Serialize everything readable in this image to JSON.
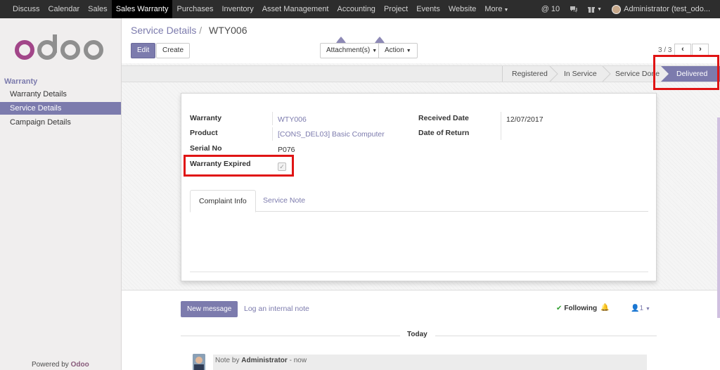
{
  "navbar": {
    "menu": [
      "Discuss",
      "Calendar",
      "Sales",
      "Sales Warranty",
      "Purchases",
      "Inventory",
      "Asset Management",
      "Accounting",
      "Project",
      "Events",
      "Website",
      "More"
    ],
    "active": "Sales Warranty",
    "messages_count": "10",
    "user": "Administrator (test_odo..."
  },
  "sidebar": {
    "logo": "odoo",
    "section": "Warranty",
    "items": [
      {
        "label": "Warranty Details"
      },
      {
        "label": "Service Details"
      },
      {
        "label": "Campaign Details"
      }
    ],
    "active_item": "Service Details",
    "powered_by": "Powered by",
    "powered_brand": "Odoo"
  },
  "control_panel": {
    "breadcrumb_parent": "Service Details",
    "breadcrumb_sep": "/",
    "breadcrumb_current": "WTY006",
    "edit_label": "Edit",
    "create_label": "Create",
    "attachments_label": "Attachment(s)",
    "action_label": "Action",
    "pager": "3 / 3",
    "prev_icon": "‹",
    "next_icon": "›"
  },
  "statusbar": {
    "stages": [
      "Registered",
      "In Service",
      "Service Done",
      "Delivered"
    ],
    "current": "Delivered"
  },
  "form": {
    "warranty_label": "Warranty",
    "warranty_value": "WTY006",
    "product_label": "Product",
    "product_value": "[CONS_DEL03] Basic Computer",
    "serial_label": "Serial No",
    "serial_value": "P076",
    "expired_label": "Warranty Expired",
    "expired_checked": true,
    "received_label": "Received Date",
    "received_value": "12/07/2017",
    "return_label": "Date of Return",
    "return_value": ""
  },
  "tabs": [
    {
      "label": "Complaint Info",
      "active": true
    },
    {
      "label": "Service Note",
      "active": false
    }
  ],
  "chatter": {
    "new_message": "New message",
    "log_note": "Log an internal note",
    "following": "Following",
    "followers_count": "1",
    "today": "Today",
    "message_prefix": "Note by",
    "message_author": "Administrator",
    "message_time": "- now"
  },
  "colors": {
    "brand": "#7c7bad",
    "odoo_purple": "#875a7b",
    "highlight": "#e01414",
    "navbar": "#2d2d2d"
  }
}
